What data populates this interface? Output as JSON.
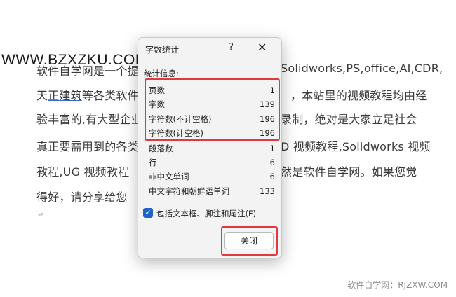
{
  "document": {
    "lines": [
      "软件自学网是一个提供",
      "天正建筑等各类软件",
      "验丰富的,有大型企业",
      "真正要需用到的各类",
      "教程,UG 视频教程",
      "得好，请分享给您"
    ],
    "right_lines": [
      "Solidworks,PS,office,AI,CDR,",
      "，本站里的视频教程均由经",
      "录制，绝对是大家立足社会",
      "D 视频教程,Solidworks 视频",
      "然是软件自学网。如果您觉",
      ""
    ],
    "underlined_text": "正建筑",
    "paragraph_mark": "↵"
  },
  "watermark_top": "WWW.BZXZKU.COM",
  "watermark_bottom": "软件自学网：RJZXW.COM",
  "dialog": {
    "title": "字数统计",
    "help_glyph": "?",
    "close_glyph": "✕",
    "section_label": "统计信息:",
    "stats": [
      {
        "label": "页数",
        "value": "1"
      },
      {
        "label": "字数",
        "value": "139"
      },
      {
        "label": "字符数(不计空格)",
        "value": "196"
      },
      {
        "label": "字符数(计空格)",
        "value": "196"
      },
      {
        "label": "段落数",
        "value": "1"
      },
      {
        "label": "行",
        "value": "6"
      },
      {
        "label": "非中文单词",
        "value": "6"
      },
      {
        "label": "中文字符和朝鲜语单词",
        "value": "133"
      }
    ],
    "checkbox_label": "包括文本框、脚注和尾注(F)",
    "checkbox_checked": true,
    "close_button": "关闭"
  },
  "colors": {
    "annotation": "#e03a3e",
    "checkbox": "#1f64c4"
  }
}
